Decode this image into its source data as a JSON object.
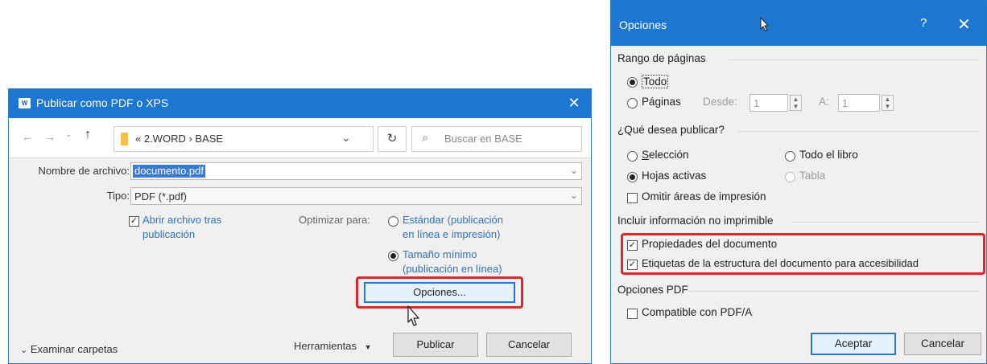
{
  "publish_dialog": {
    "title": "Publicar como PDF o XPS",
    "path": {
      "crumbs": "« 2.WORD  ›  BASE",
      "search_placeholder": "Buscar en BASE"
    },
    "filename": {
      "label": "Nombre de archivo:",
      "value": "documento.pdf"
    },
    "filetype": {
      "label": "Tipo:",
      "value": "PDF (*.pdf)"
    },
    "open_after": {
      "line1": "Abrir archivo tras",
      "line2": "publicación"
    },
    "optimize": {
      "label": "Optimizar para:",
      "standard_line1": "Estándar (publicación",
      "standard_line2": "en línea e impresión)",
      "minimum_line1": "Tamaño mínimo",
      "minimum_line2": "(publicación en línea)"
    },
    "options_button": "Opciones...",
    "browse_folders": "Examinar carpetas",
    "tools": "Herramientas",
    "publish_button": "Publicar",
    "cancel_button": "Cancelar"
  },
  "options_dialog": {
    "title": "Opciones",
    "help": "?",
    "page_range": {
      "header": "Rango de páginas",
      "all": "Todo",
      "pages": "Páginas",
      "from_label": "Desde:",
      "from_value": "1",
      "to_label": "A:",
      "to_value": "1"
    },
    "publish_what": {
      "header": "¿Qué desea publicar?",
      "selection": "Selección",
      "entire_workbook": "Todo el libro",
      "active_sheets": "Hojas activas",
      "table": "Tabla",
      "ignore_print_areas": "Omitir áreas de impresión"
    },
    "nonprintable": {
      "header": "Incluir información no imprimible",
      "doc_properties": "Propiedades del documento",
      "structure_tags": "Etiquetas de la estructura del documento para accesibilidad"
    },
    "pdf_options": {
      "header": "Opciones PDF",
      "pdfa": "Compatible con PDF/A"
    },
    "ok_button": "Aceptar",
    "cancel_button": "Cancelar"
  },
  "colors": {
    "titlebar": "#1d76d0",
    "highlight_red": "#e0262b",
    "link_blue": "#2f71c4"
  }
}
